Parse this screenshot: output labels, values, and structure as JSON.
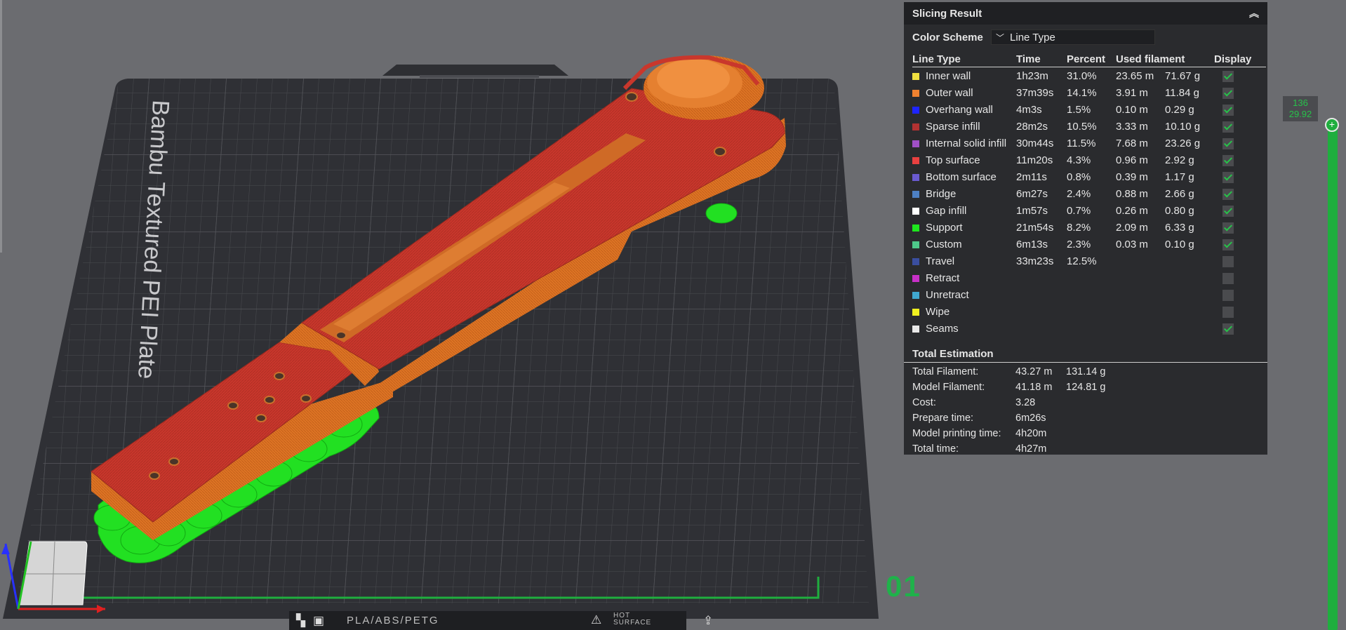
{
  "bed": {
    "label": "Bambu Textured PEI Plate",
    "plate_number": "01",
    "bottom_bar": {
      "filament_types": "PLA/ABS/PETG",
      "hot_surface_line1": "HOT",
      "hot_surface_line2": "SURFACE"
    }
  },
  "slicing_result": {
    "title": "Slicing Result",
    "color_scheme_label": "Color Scheme",
    "color_scheme_value": "Line Type",
    "columns": [
      "Line Type",
      "Time",
      "Percent",
      "Used filament",
      "Display"
    ],
    "rows": [
      {
        "name": "Inner wall",
        "color": "#f0e040",
        "time": "1h23m",
        "percent": "31.0%",
        "length": "23.65 m",
        "weight": "71.67 g",
        "display": true
      },
      {
        "name": "Outer wall",
        "color": "#f08230",
        "time": "37m39s",
        "percent": "14.1%",
        "length": "3.91 m",
        "weight": "11.84 g",
        "display": true
      },
      {
        "name": "Overhang wall",
        "color": "#1e24ff",
        "time": "4m3s",
        "percent": "1.5%",
        "length": "0.10 m",
        "weight": "0.29 g",
        "display": true
      },
      {
        "name": "Sparse infill",
        "color": "#b23232",
        "time": "28m2s",
        "percent": "10.5%",
        "length": "3.33 m",
        "weight": "10.10 g",
        "display": true
      },
      {
        "name": "Internal solid infill",
        "color": "#a050c8",
        "time": "30m44s",
        "percent": "11.5%",
        "length": "7.68 m",
        "weight": "23.26 g",
        "display": true
      },
      {
        "name": "Top surface",
        "color": "#e84040",
        "time": "11m20s",
        "percent": "4.3%",
        "length": "0.96 m",
        "weight": "2.92 g",
        "display": true
      },
      {
        "name": "Bottom surface",
        "color": "#6a5ad0",
        "time": "2m11s",
        "percent": "0.8%",
        "length": "0.39 m",
        "weight": "1.17 g",
        "display": true
      },
      {
        "name": "Bridge",
        "color": "#4d80c4",
        "time": "6m27s",
        "percent": "2.4%",
        "length": "0.88 m",
        "weight": "2.66 g",
        "display": true
      },
      {
        "name": "Gap infill",
        "color": "#ffffff",
        "time": "1m57s",
        "percent": "0.7%",
        "length": "0.26 m",
        "weight": "0.80 g",
        "display": true
      },
      {
        "name": "Support",
        "color": "#1ee61e",
        "time": "21m54s",
        "percent": "8.2%",
        "length": "2.09 m",
        "weight": "6.33 g",
        "display": true
      },
      {
        "name": "Custom",
        "color": "#4ec88a",
        "time": "6m13s",
        "percent": "2.3%",
        "length": "0.03 m",
        "weight": "0.10 g",
        "display": true
      },
      {
        "name": "Travel",
        "color": "#3a4ea0",
        "time": "33m23s",
        "percent": "12.5%",
        "length": "",
        "weight": "",
        "display": false
      },
      {
        "name": "Retract",
        "color": "#c830c8",
        "time": "",
        "percent": "",
        "length": "",
        "weight": "",
        "display": false
      },
      {
        "name": "Unretract",
        "color": "#40a8d0",
        "time": "",
        "percent": "",
        "length": "",
        "weight": "",
        "display": false
      },
      {
        "name": "Wipe",
        "color": "#f0f020",
        "time": "",
        "percent": "",
        "length": "",
        "weight": "",
        "display": false
      },
      {
        "name": "Seams",
        "color": "#e8e8e8",
        "time": "",
        "percent": "",
        "length": "",
        "weight": "",
        "display": true
      }
    ],
    "total_estimation": {
      "title": "Total Estimation",
      "rows": [
        {
          "label": "Total Filament:",
          "v1": "43.27 m",
          "v2": "131.14 g"
        },
        {
          "label": "Model Filament:",
          "v1": "41.18 m",
          "v2": "124.81 g"
        },
        {
          "label": "Cost:",
          "v1": "3.28",
          "v2": ""
        },
        {
          "label": "Prepare time:",
          "v1": "6m26s",
          "v2": ""
        },
        {
          "label": "Model printing time:",
          "v1": "4h20m",
          "v2": ""
        },
        {
          "label": "Total time:",
          "v1": "4h27m",
          "v2": ""
        }
      ]
    }
  },
  "layer_slider": {
    "layer": "136",
    "height": "29.92",
    "thumb_glyph": "+"
  }
}
